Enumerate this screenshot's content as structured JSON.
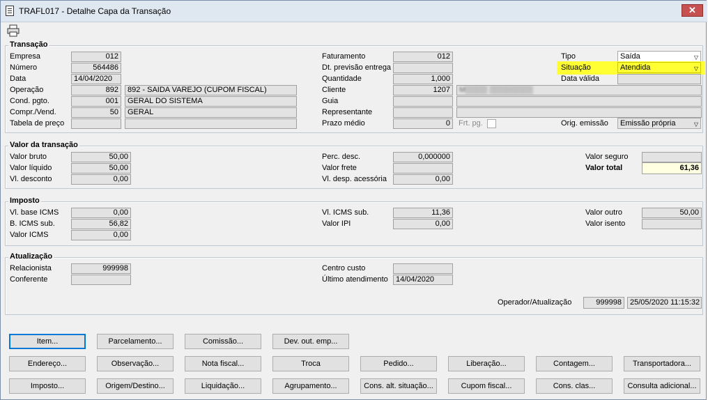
{
  "window": {
    "title": "TRAFL017 - Detalhe Capa da Transação",
    "close": "✕"
  },
  "transacao": {
    "legend": "Transação",
    "empresa_label": "Empresa",
    "empresa": "012",
    "numero_label": "Número",
    "numero": "564486",
    "data_label": "Data",
    "data": "14/04/2020",
    "operacao_label": "Operação",
    "operacao_code": "892",
    "operacao_desc": "892 - SAIDA VAREJO (CUPOM FISCAL)",
    "cond_label": "Cond. pgto.",
    "cond_code": "001",
    "cond_desc": "GERAL DO SISTEMA",
    "compr_label": "Compr./Vend.",
    "compr_code": "50",
    "compr_desc": "GERAL",
    "tabela_label": "Tabela de preço",
    "faturamento_label": "Faturamento",
    "faturamento": "012",
    "dtprev_label": "Dt. previsão entrega",
    "quantidade_label": "Quantidade",
    "quantidade": "1,000",
    "cliente_label": "Cliente",
    "cliente_code": "1207",
    "cliente_name": "M▒▒▒▒ ▒▒▒▒▒▒▒▒",
    "guia_label": "Guia",
    "representante_label": "Representante",
    "prazo_label": "Prazo médio",
    "prazo": "0",
    "frt_label": "Frt. pg.",
    "tipo_label": "Tipo",
    "tipo": "Saída",
    "situacao_label": "Situação",
    "situacao": "Atendida",
    "datavalida_label": "Data válida",
    "orig_label": "Orig. emissão",
    "orig": "Emissão própria"
  },
  "valor": {
    "legend": "Valor da transação",
    "bruto_label": "Valor bruto",
    "bruto": "50,00",
    "liquido_label": "Valor líquido",
    "liquido": "50,00",
    "desconto_label": "Vl. desconto",
    "desconto": "0,00",
    "percdesc_label": "Perc. desc.",
    "percdesc": "0,000000",
    "frete_label": "Valor frete",
    "desp_label": "Vl. desp. acessória",
    "desp": "0,00",
    "seguro_label": "Valor seguro",
    "total_label": "Valor total",
    "total": "61,36"
  },
  "imposto": {
    "legend": "Imposto",
    "baseicms_label": "Vl. base ICMS",
    "baseicms": "0,00",
    "bicmssub_label": "B. ICMS sub.",
    "bicmssub": "56,82",
    "valoricms_label": "Valor ICMS",
    "valoricms": "0,00",
    "icmssub_label": "Vl. ICMS sub.",
    "icmssub": "11,36",
    "ipi_label": "Valor IPI",
    "ipi": "0,00",
    "outro_label": "Valor outro",
    "outro": "50,00",
    "isento_label": "Valor isento"
  },
  "atualizacao": {
    "legend": "Atualização",
    "relacionista_label": "Relacionista",
    "relacionista": "999998",
    "conferente_label": "Conferente",
    "centro_label": "Centro custo",
    "ultimo_label": "Último atendimento",
    "ultimo": "14/04/2020",
    "operador_label": "Operador/Atualização",
    "operador": "999998",
    "operador_data": "25/05/2020 11:15:32"
  },
  "buttons": {
    "item": "Item...",
    "parcelamento": "Parcelamento...",
    "comissao": "Comissão...",
    "devout": "Dev. out. emp...",
    "endereco": "Endereço...",
    "observacao": "Observação...",
    "notafiscal": "Nota fiscal...",
    "troca": "Troca",
    "pedido": "Pedido...",
    "liberacao": "Liberação...",
    "contagem": "Contagem...",
    "transportadora": "Transportadora...",
    "imposto": "Imposto...",
    "origem": "Origem/Destino...",
    "liquidacao": "Liquidação...",
    "agrupamento": "Agrupamento...",
    "consalt": "Cons. alt. situação...",
    "cupom": "Cupom fiscal...",
    "consclas": "Cons. clas...",
    "consulta": "Consulta adicional..."
  },
  "colors": {
    "highlight": "#ffff33",
    "focus": "#0078d7",
    "close": "#c75050"
  }
}
